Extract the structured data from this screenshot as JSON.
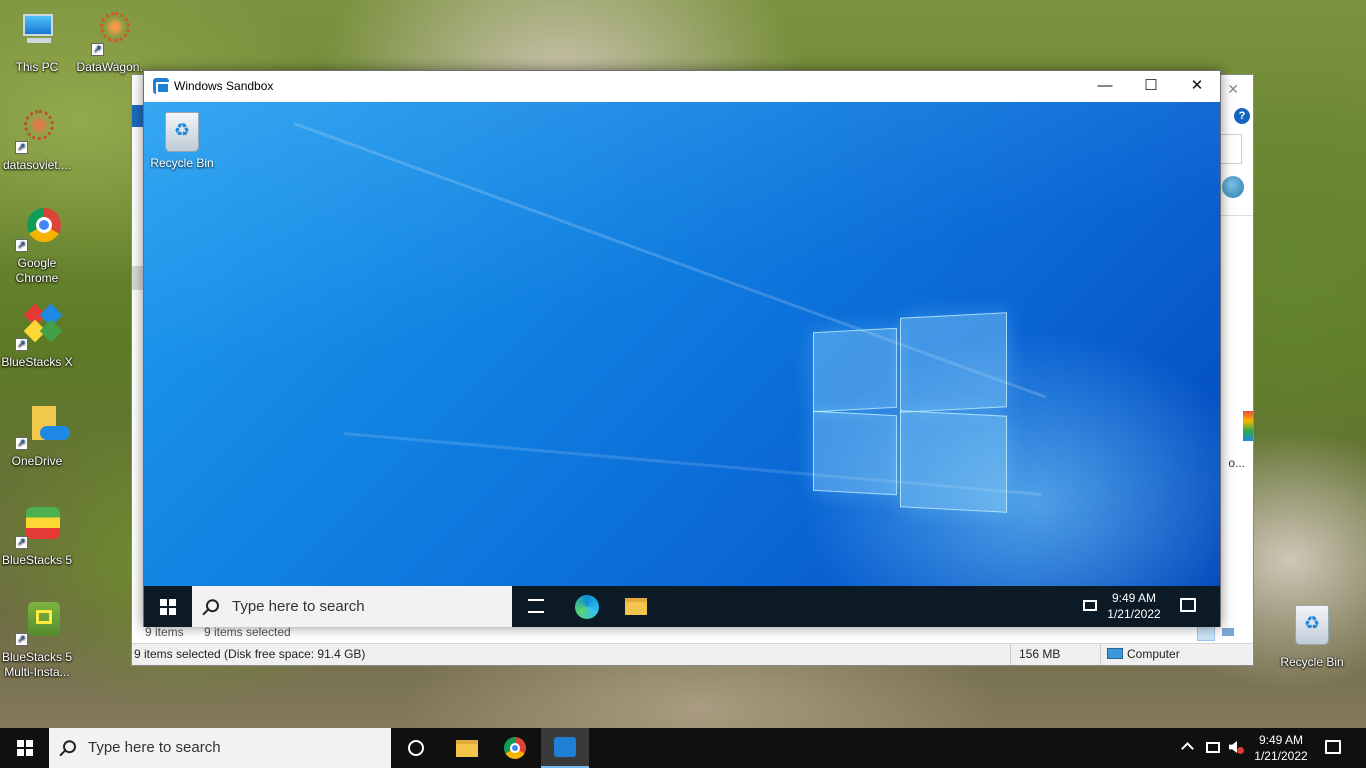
{
  "desktop": {
    "icons": [
      {
        "label": "This PC"
      },
      {
        "label": "DataWagon..."
      },
      {
        "label": "datasoviet...."
      },
      {
        "label": "Google Chrome"
      },
      {
        "label": "BlueStacks X"
      },
      {
        "label": "OneDrive"
      },
      {
        "label": "BlueStacks 5"
      },
      {
        "label": "BlueStacks 5 Multi-Insta..."
      },
      {
        "label": "Recycle Bin"
      }
    ]
  },
  "explorer": {
    "item_count": "9 items",
    "selected_count": "9 items selected",
    "status_text": "9 items selected (Disk free space: 91.4 GB)",
    "size": "156 MB",
    "location": "Computer",
    "help_label": "?",
    "truncated_label": "o..."
  },
  "sandbox": {
    "title": "Windows Sandbox",
    "minimize": "—",
    "maximize": "☐",
    "close": "✕",
    "desktop_icon": "Recycle Bin",
    "taskbar": {
      "search_placeholder": "Type here to search",
      "time": "9:49 AM",
      "date": "1/21/2022"
    }
  },
  "host_taskbar": {
    "search_placeholder": "Type here to search",
    "time": "9:49 AM",
    "date": "1/21/2022"
  }
}
